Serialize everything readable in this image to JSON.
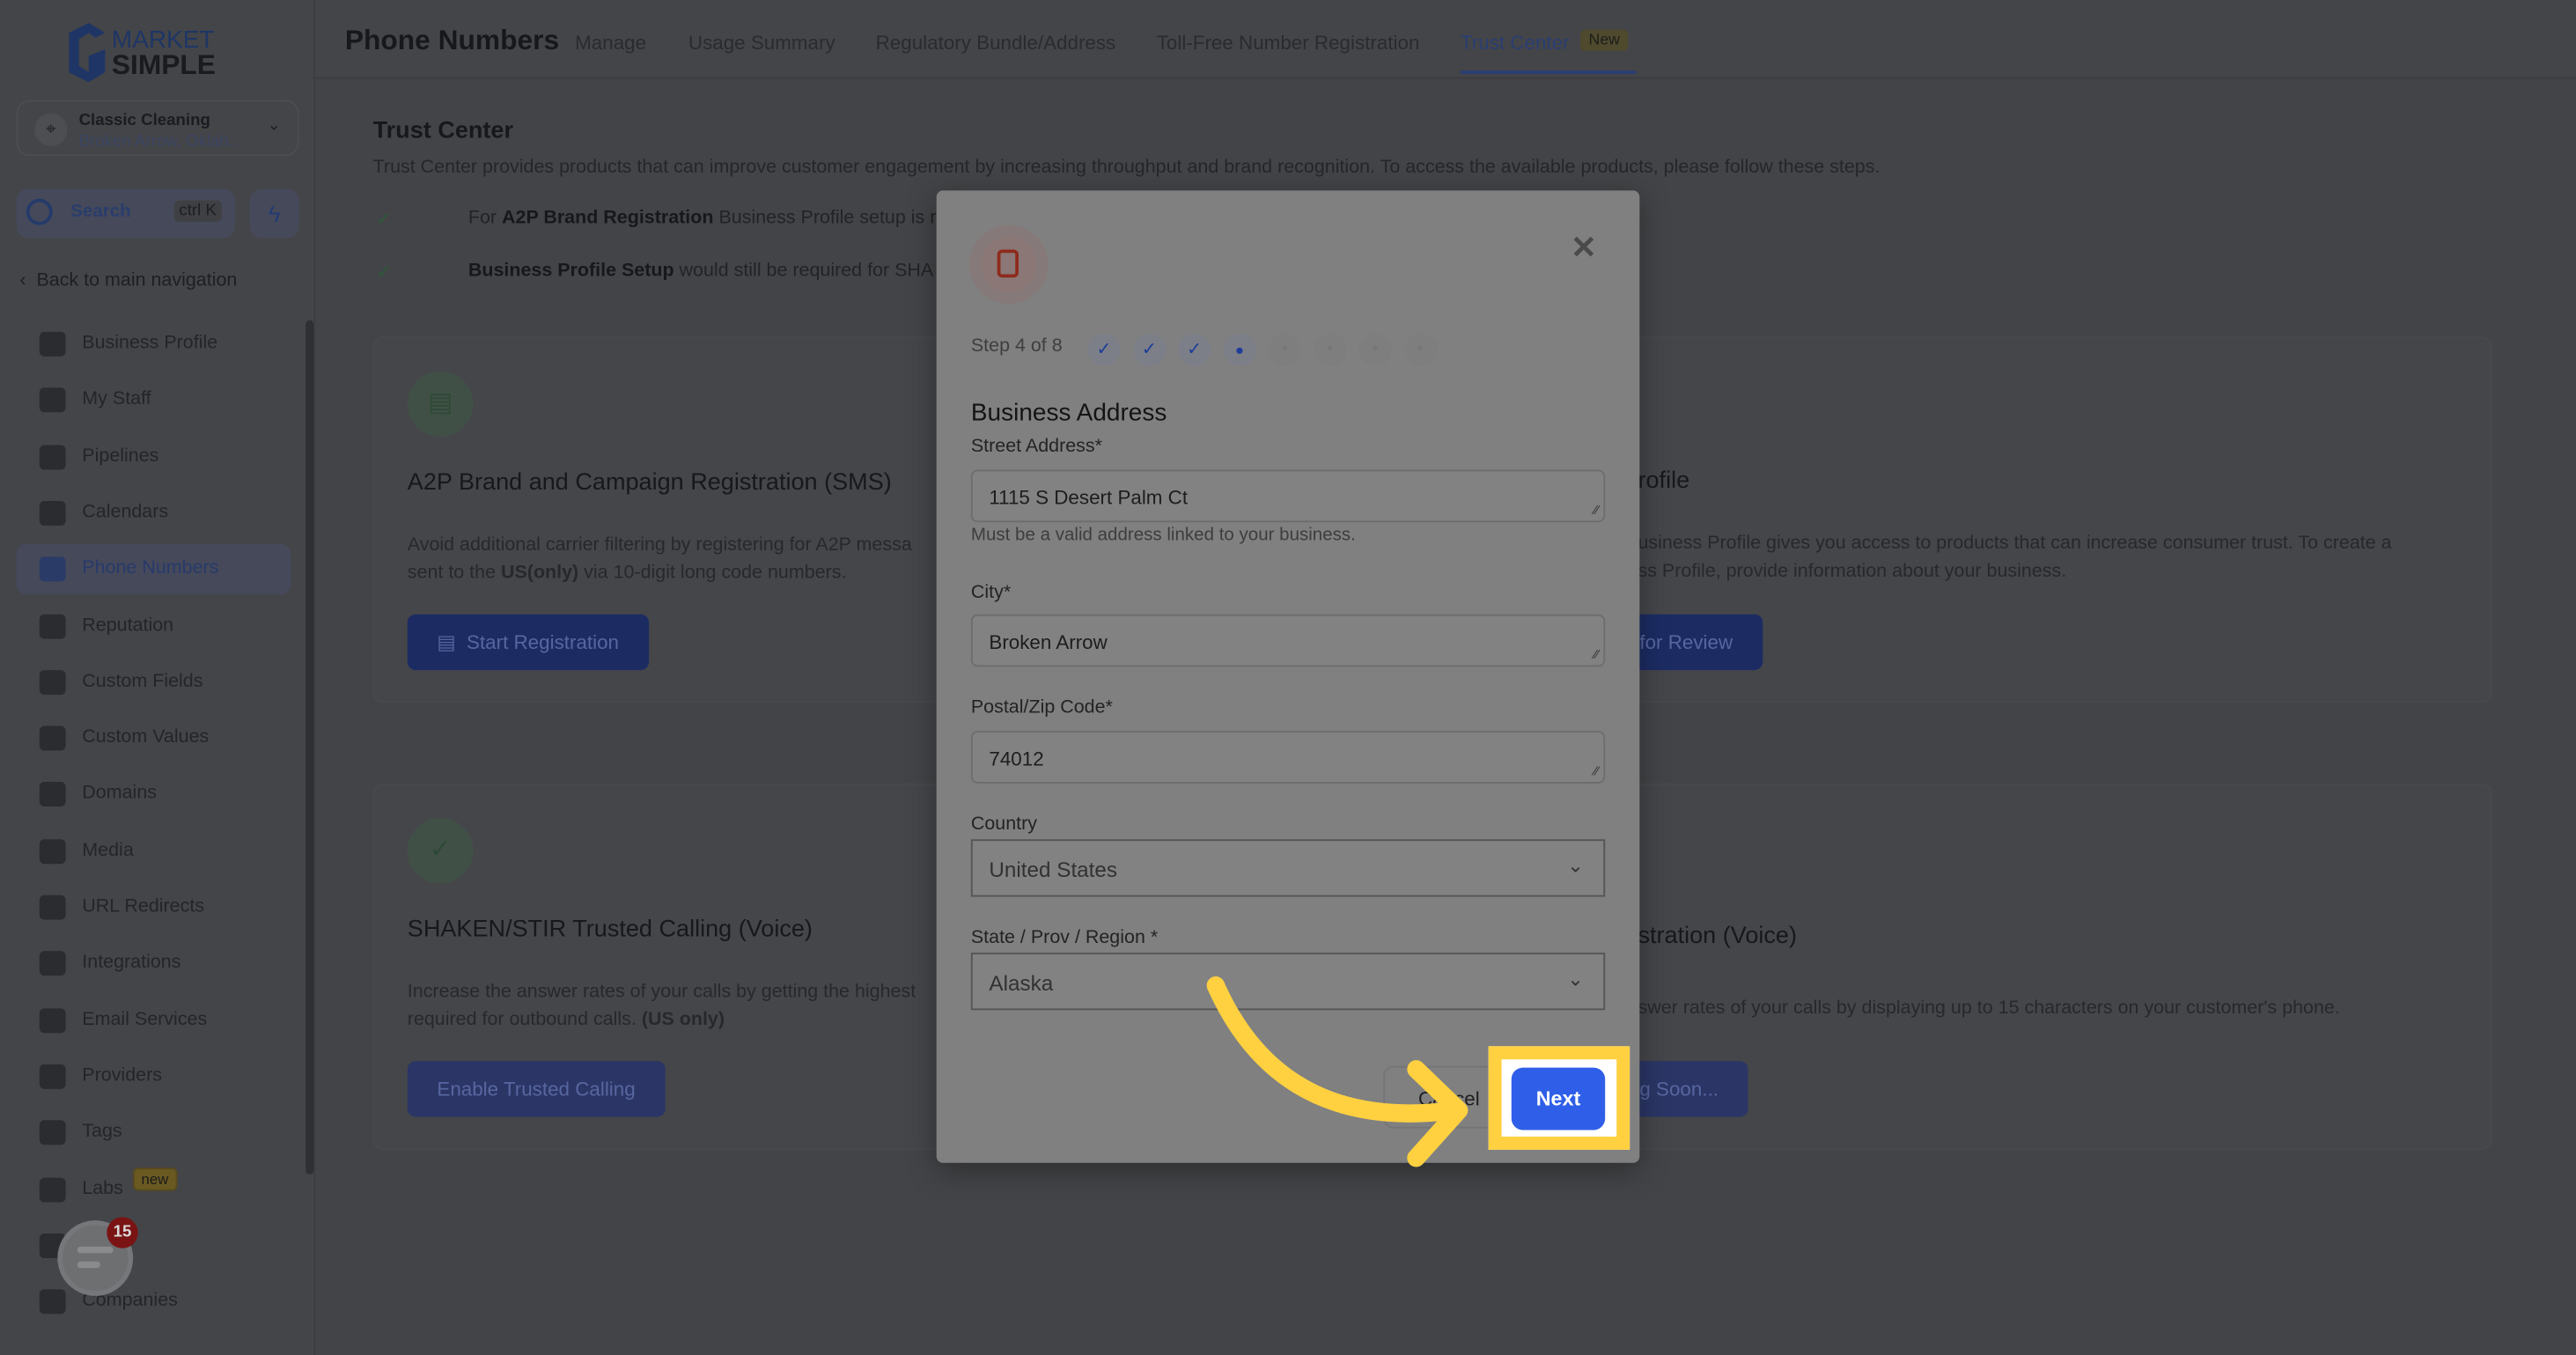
{
  "brand": {
    "logo_text_top": "MARKET",
    "logo_text_bottom": "SIMPLE",
    "colors": {
      "accent": "#2F5FE8",
      "highlight": "#FFD140"
    }
  },
  "account": {
    "name": "Classic Cleaning",
    "location": "Broken Arrow, Oklah...",
    "icon": "location-pin-icon"
  },
  "search": {
    "label": "Search",
    "shortcut": "ctrl K"
  },
  "back_nav": "Back to main navigation",
  "sidebar": {
    "items": [
      {
        "label": "Business Profile"
      },
      {
        "label": "My Staff"
      },
      {
        "label": "Pipelines"
      },
      {
        "label": "Calendars"
      },
      {
        "label": "Phone Numbers",
        "active": true
      },
      {
        "label": "Reputation"
      },
      {
        "label": "Custom Fields"
      },
      {
        "label": "Custom Values"
      },
      {
        "label": "Domains"
      },
      {
        "label": "Media"
      },
      {
        "label": "URL Redirects"
      },
      {
        "label": "Integrations"
      },
      {
        "label": "Email Services"
      },
      {
        "label": "Providers"
      },
      {
        "label": "Tags"
      },
      {
        "label": "Labs",
        "badge": "new"
      },
      {
        "label": "Logs"
      },
      {
        "label": "Companies"
      }
    ],
    "chat_count": "15"
  },
  "header": {
    "title": "Phone Numbers",
    "tabs": [
      {
        "label": "Manage"
      },
      {
        "label": "Usage Summary"
      },
      {
        "label": "Regulatory Bundle/Address"
      },
      {
        "label": "Toll-Free Number Registration"
      },
      {
        "label": "Trust Center",
        "active": true,
        "badge": "New"
      }
    ]
  },
  "trust": {
    "title": "Trust Center",
    "desc": "Trust Center provides products that can improve customer engagement by increasing throughput and brand recognition. To access the available products, please follow these steps.",
    "steps": [
      {
        "pre": "For ",
        "bold": "A2P Brand Registration",
        "post": " Business Profile setup is r"
      },
      {
        "pre": "",
        "bold": "Business Profile Setup",
        "post": " would still be required for SHA"
      }
    ]
  },
  "cards": [
    {
      "title": "A2P Brand and Campaign Registration (SMS)",
      "desc1": "Avoid additional carrier filtering by registering for A2P messa",
      "desc2_pre": "sent to the ",
      "desc2_bold": "US(only)",
      "desc2_post": " via 10-digit long code numbers.",
      "button": "Start Registration"
    },
    {
      "title": "SHAKEN/STIR Trusted Calling (Voice)",
      "desc1": "Increase the answer rates of your calls by getting the highest",
      "desc2_pre": "required for outbound calls. ",
      "desc2_bold": "(US only)",
      "desc2_post": "",
      "button": "Enable Trusted Calling"
    }
  ],
  "right_fragments": {
    "card1_title": "rofile",
    "card1_desc1": "usiness Profile gives you access to products that can increase consumer trust. To create a",
    "card1_desc2": "ss Profile, provide information about your business.",
    "card1_button": "for Review",
    "card2_title": "stration (Voice)",
    "card2_desc": "swer rates of your calls by displaying up to 15 characters on your customer's phone.",
    "card2_button": "g Soon..."
  },
  "modal": {
    "step_text": "Step 4 of 8",
    "current_step": 4,
    "total_steps": 8,
    "heading": "Business Address",
    "street": {
      "label": "Street Address*",
      "value": "1115 S Desert Palm Ct",
      "help": "Must be a valid address linked to your business."
    },
    "city": {
      "label": "City*",
      "value": "Broken Arrow"
    },
    "zip": {
      "label": "Postal/Zip Code*",
      "value": "74012"
    },
    "country": {
      "label": "Country",
      "value": "United States"
    },
    "state": {
      "label": "State / Prov / Region *",
      "value": "Alaska"
    },
    "cancel": "Cancel",
    "next": "Next"
  }
}
